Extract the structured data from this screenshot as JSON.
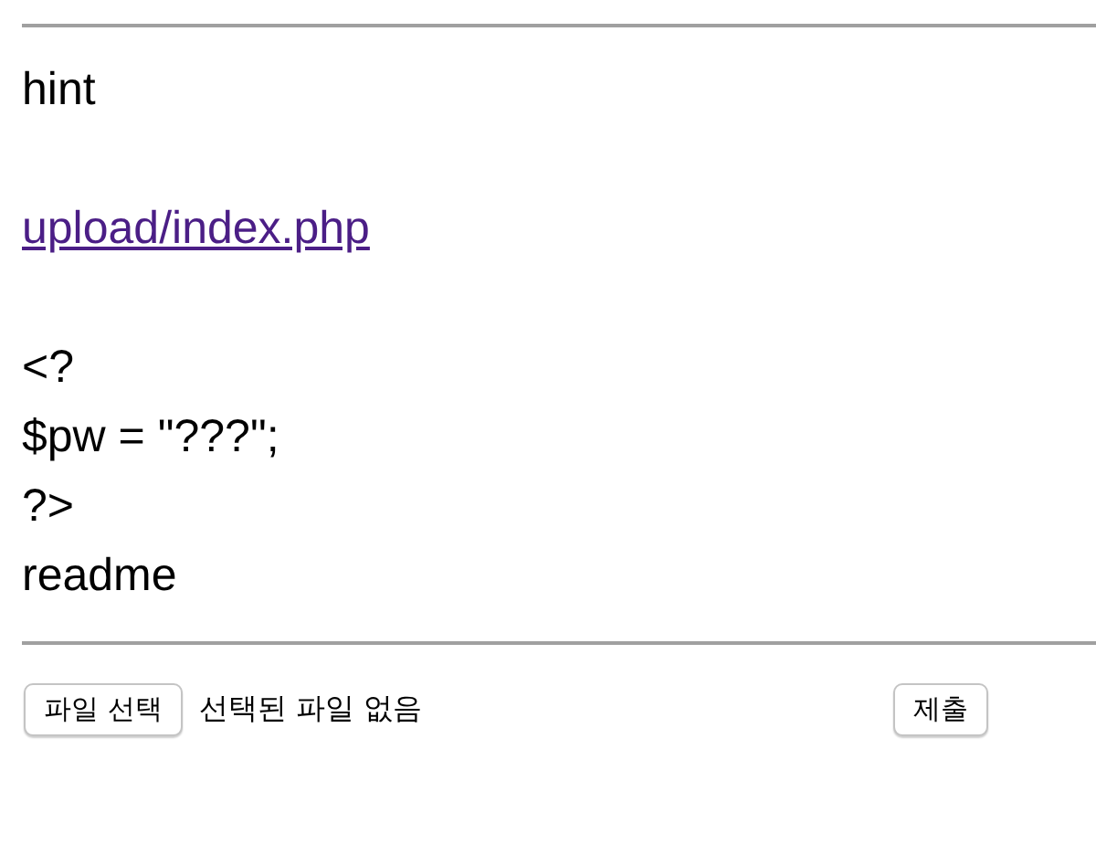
{
  "lines": [
    {
      "kind": "text",
      "text": "hint"
    },
    {
      "kind": "blank"
    },
    {
      "kind": "link",
      "text": "upload/index.php"
    },
    {
      "kind": "blank"
    },
    {
      "kind": "text",
      "text": "<?"
    },
    {
      "kind": "text",
      "text": "$pw = \"???\";"
    },
    {
      "kind": "text",
      "text": "?>"
    },
    {
      "kind": "text",
      "text": "readme"
    }
  ],
  "upload_form": {
    "file_button": "파일 선택",
    "file_status": "선택된 파일 없음",
    "submit_button": "제출"
  }
}
